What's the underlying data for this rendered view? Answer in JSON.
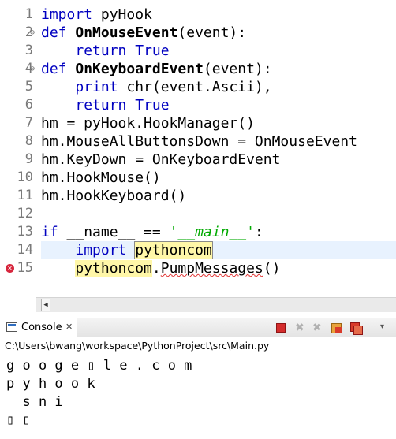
{
  "editor": {
    "lines": [
      {
        "num": "1",
        "fold": "",
        "marker": "",
        "tokens": [
          {
            "t": "import",
            "c": "kw"
          },
          {
            "t": " pyHook",
            "c": ""
          }
        ]
      },
      {
        "num": "2",
        "fold": "⊖",
        "marker": "",
        "tokens": [
          {
            "t": "def",
            "c": "kw"
          },
          {
            "t": " ",
            "c": ""
          },
          {
            "t": "OnMouseEvent",
            "c": "fn"
          },
          {
            "t": "(event):",
            "c": ""
          }
        ]
      },
      {
        "num": "3",
        "fold": "",
        "marker": "",
        "tokens": [
          {
            "t": "    ",
            "c": ""
          },
          {
            "t": "return",
            "c": "kw"
          },
          {
            "t": " ",
            "c": ""
          },
          {
            "t": "True",
            "c": "kw"
          }
        ]
      },
      {
        "num": "4",
        "fold": "⊖",
        "marker": "",
        "tokens": [
          {
            "t": "def",
            "c": "kw"
          },
          {
            "t": " ",
            "c": ""
          },
          {
            "t": "OnKeyboardEvent",
            "c": "fn"
          },
          {
            "t": "(event):",
            "c": ""
          }
        ]
      },
      {
        "num": "5",
        "fold": "",
        "marker": "",
        "tokens": [
          {
            "t": "    ",
            "c": ""
          },
          {
            "t": "print",
            "c": "kw"
          },
          {
            "t": " chr(event.Ascii),",
            "c": ""
          }
        ]
      },
      {
        "num": "6",
        "fold": "",
        "marker": "",
        "tokens": [
          {
            "t": "    ",
            "c": ""
          },
          {
            "t": "return",
            "c": "kw"
          },
          {
            "t": " ",
            "c": ""
          },
          {
            "t": "True",
            "c": "kw"
          }
        ]
      },
      {
        "num": "7",
        "fold": "",
        "marker": "",
        "tokens": [
          {
            "t": "hm = pyHook.HookManager()",
            "c": ""
          }
        ]
      },
      {
        "num": "8",
        "fold": "",
        "marker": "",
        "tokens": [
          {
            "t": "hm.MouseAllButtonsDown = OnMouseEvent",
            "c": ""
          }
        ]
      },
      {
        "num": "9",
        "fold": "",
        "marker": "",
        "tokens": [
          {
            "t": "hm.KeyDown = OnKeyboardEvent",
            "c": ""
          }
        ]
      },
      {
        "num": "10",
        "fold": "",
        "marker": "",
        "tokens": [
          {
            "t": "hm.HookMouse()",
            "c": ""
          }
        ]
      },
      {
        "num": "11",
        "fold": "",
        "marker": "",
        "tokens": [
          {
            "t": "hm.HookKeyboard()",
            "c": ""
          }
        ]
      },
      {
        "num": "12",
        "fold": "",
        "marker": "",
        "tokens": []
      },
      {
        "num": "13",
        "fold": "",
        "marker": "",
        "tokens": [
          {
            "t": "if",
            "c": "kw"
          },
          {
            "t": " __name__ == ",
            "c": ""
          },
          {
            "t": "'__main__'",
            "c": "str"
          },
          {
            "t": ":",
            "c": ""
          }
        ]
      },
      {
        "num": "14",
        "fold": "",
        "marker": "",
        "current": true,
        "tokens": [
          {
            "t": "    ",
            "c": ""
          },
          {
            "t": "import",
            "c": "kw"
          },
          {
            "t": " ",
            "c": ""
          },
          {
            "t": "pythoncom",
            "c": "occ-box"
          },
          {
            "t": "",
            "c": "caret"
          }
        ]
      },
      {
        "num": "15",
        "fold": "",
        "marker": "error",
        "tokens": [
          {
            "t": "    ",
            "c": ""
          },
          {
            "t": "pythoncom",
            "c": "occ"
          },
          {
            "t": ".",
            "c": ""
          },
          {
            "t": "PumpMessages",
            "c": "err"
          },
          {
            "t": "()",
            "c": ""
          }
        ]
      }
    ]
  },
  "console": {
    "tab_label": "Console",
    "tab_close": "✕",
    "path": "C:\\Users\\bwang\\workspace\\PythonProject\\src\\Main.py",
    "output": [
      "g o o g e ▯ l e . c o m",
      "p y h o o k",
      "  s n i",
      "▯ ▯"
    ],
    "toolbar": {
      "remove": "✖",
      "remove_all": "✖",
      "more": "▾"
    }
  },
  "colors": {
    "keyword": "#0000c0",
    "string": "#00aa00",
    "current_line": "#e8f2fe",
    "occurrence": "#fff7a8",
    "error": "#d7263d"
  }
}
